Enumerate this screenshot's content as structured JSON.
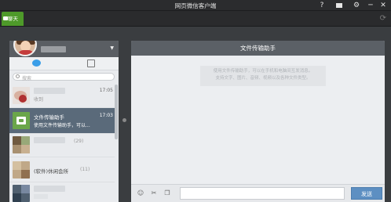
{
  "window": {
    "title": "网页微信客户端",
    "controls": [
      "?",
      "▪",
      "⚙",
      "─",
      "✕"
    ]
  },
  "tabs": {
    "chat_label": "聊天"
  },
  "sidebar": {
    "search_placeholder": "搜索",
    "conversations": [
      {
        "name": "",
        "message": "收到",
        "time": "17:05"
      },
      {
        "name": "文件传输助手",
        "message": "使用文件传输助手，可以...",
        "time": "17:03"
      },
      {
        "name": "",
        "count": "(29)"
      },
      {
        "name": "(软件)休闲会所",
        "count": "(11)"
      },
      {
        "name": ""
      }
    ]
  },
  "chat": {
    "title": "文件传输助手",
    "notice_lines": [
      "使用文件传输助手，可以在手机和电脑间互发消息。",
      "支持文字、图片、音频、视频以及各种文件类型。"
    ],
    "send_label": "发送"
  },
  "colors": {
    "accent_green": "#4e9a2a",
    "send_blue": "#5d8fc2",
    "active_item": "#5a6a7a"
  }
}
